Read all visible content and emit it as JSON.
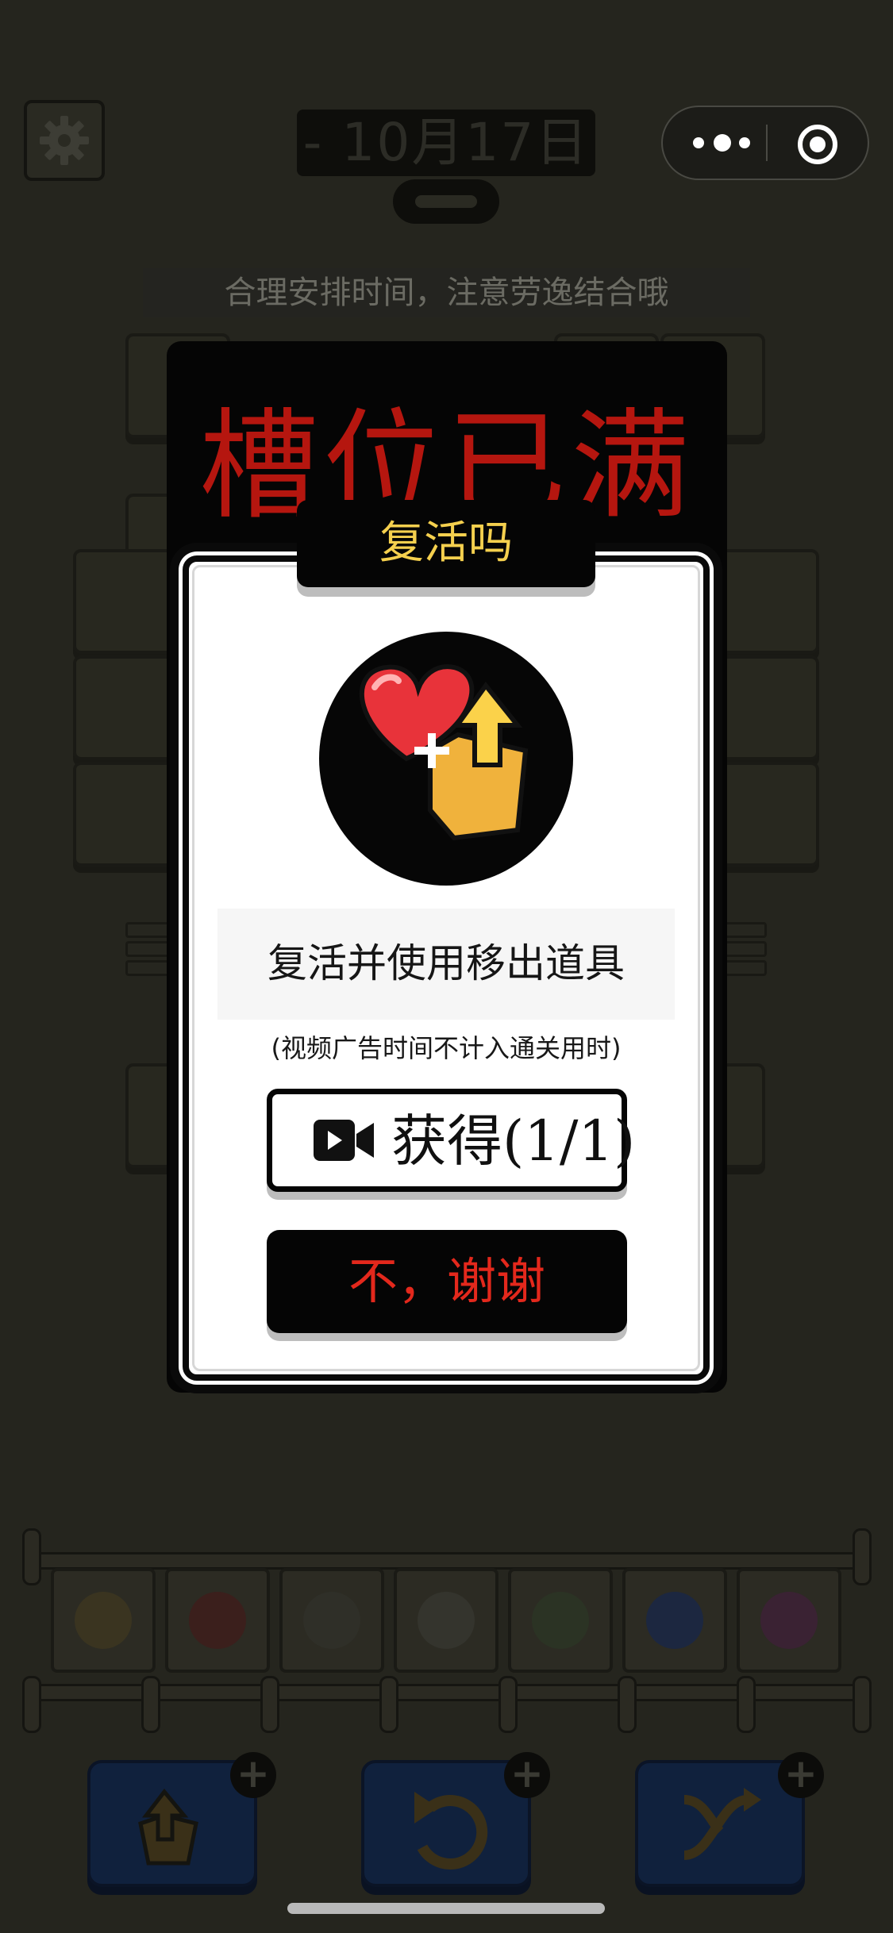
{
  "header": {
    "date": "- 10月17日 -",
    "tip": "合理安排时间，注意劳逸结合哦"
  },
  "capsule": {
    "more_icon": "more-dots-icon",
    "close_icon": "target-circle-icon"
  },
  "board": {
    "full_title": "槽位已满"
  },
  "rack": {
    "slots": [
      "wheat-bundle",
      "red-bucket",
      "garden-fork",
      "fluffy-ball",
      "grass-tuft",
      "blue-trowel",
      "yarn-ball"
    ]
  },
  "tools": [
    {
      "icon": "move-out-icon"
    },
    {
      "icon": "undo-icon"
    },
    {
      "icon": "shuffle-icon"
    }
  ],
  "dialog": {
    "tab_title": "复活吗",
    "icon": "heart-plus-moveout-icon",
    "message": "复活并使用移出道具",
    "note": "(视频广告时间不计入通关用时)",
    "get_button": "获得(1/1)",
    "get_icon": "video-camera-icon",
    "decline_button": "不，谢谢"
  },
  "colors": {
    "accent_yellow": "#f5d04e",
    "alert_red": "#e3281c",
    "heart_red": "#e8333a"
  }
}
